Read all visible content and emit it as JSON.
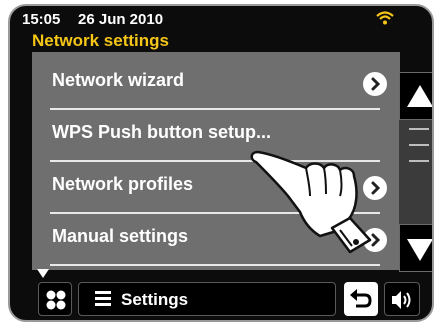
{
  "status": {
    "time": "15:05",
    "date": "26 Jun 2010"
  },
  "header": {
    "title": "Network settings"
  },
  "menu": {
    "items": [
      {
        "label": "Network wizard"
      },
      {
        "label": "WPS Push button setup..."
      },
      {
        "label": "Network profiles"
      },
      {
        "label": "Manual settings"
      }
    ]
  },
  "bottom_bar": {
    "current_menu_label": "Settings"
  },
  "colors": {
    "title": "#f5c518",
    "panel": "#6f6f6f",
    "background": "#0c0c0c"
  },
  "icons": [
    "wifi-icon",
    "chevron-right-icon",
    "scroll-up-icon",
    "scroll-down-icon",
    "home-grid-icon",
    "list-icon",
    "back-icon",
    "volume-icon",
    "more-down-icon",
    "pointing-hand-icon"
  ]
}
